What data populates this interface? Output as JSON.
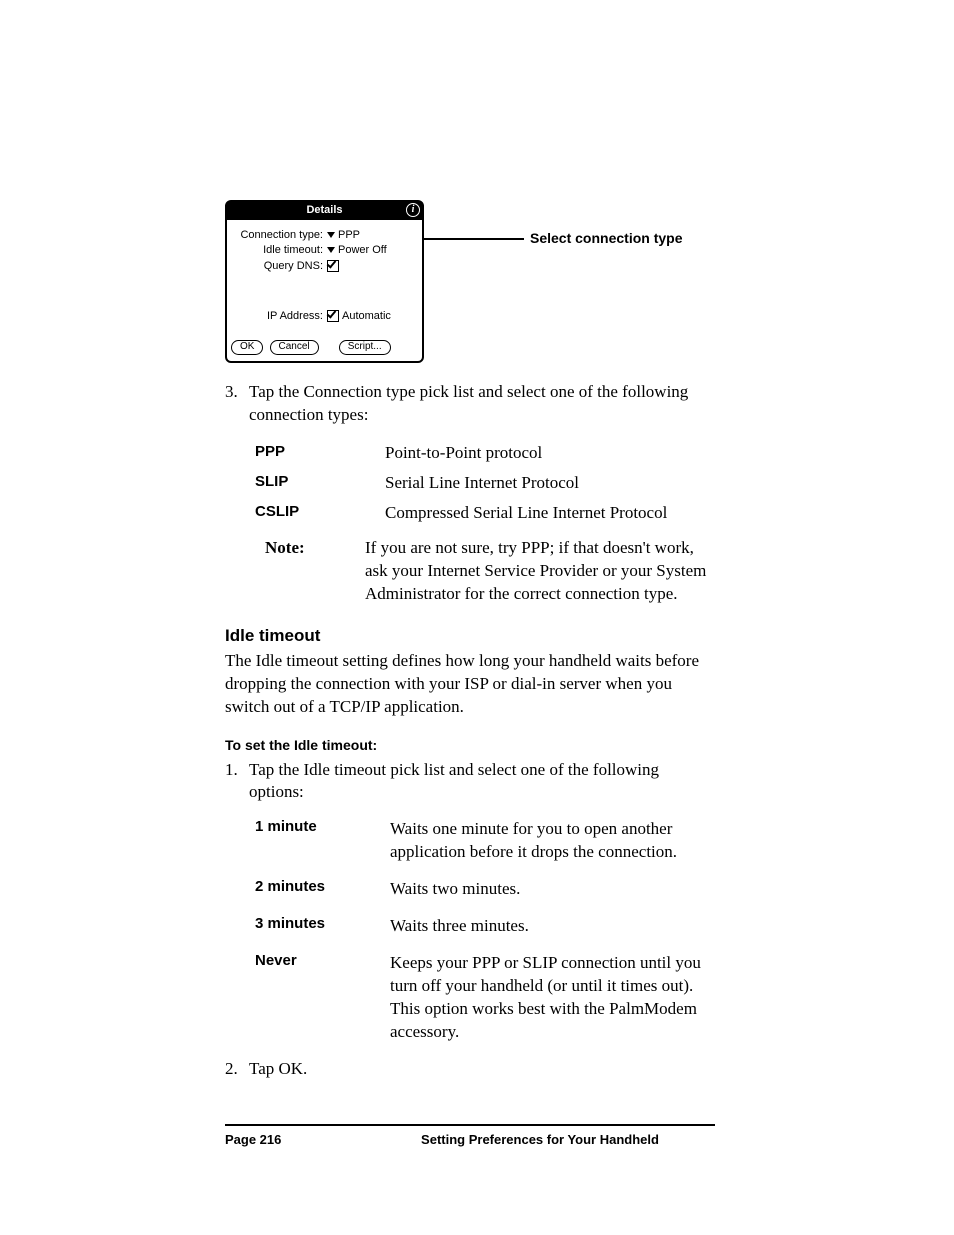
{
  "dialog": {
    "title": "Details",
    "info_glyph": "i",
    "rows": {
      "conn_label": "Connection type:",
      "conn_value": "PPP",
      "idle_label": "Idle timeout:",
      "idle_value": "Power Off",
      "qdns_label": "Query DNS:",
      "ip_label": "IP Address:",
      "ip_value": "Automatic"
    },
    "buttons": {
      "ok": "OK",
      "cancel": "Cancel",
      "script": "Script..."
    }
  },
  "callout": "Select connection type",
  "step3": {
    "num": "3.",
    "text": "Tap the Connection type pick list and select one of the following connection types:"
  },
  "protocols": [
    {
      "label": "PPP",
      "desc": "Point-to-Point protocol"
    },
    {
      "label": "SLIP",
      "desc": "Serial Line Internet Protocol"
    },
    {
      "label": "CSLIP",
      "desc": "Compressed Serial Line Internet Protocol"
    }
  ],
  "note": {
    "label": "Note:",
    "text": "If you are not sure, try PPP; if that doesn't work, ask your Internet Service Provider or your System Administrator for the correct connection type."
  },
  "idle_heading": "Idle timeout",
  "idle_para": "The Idle timeout setting defines how long your handheld waits before dropping the connection with your ISP or dial-in server when you switch out of a TCP/IP application.",
  "set_heading": "To set the Idle timeout:",
  "step1": {
    "num": "1.",
    "text": "Tap the Idle timeout pick list and select one of the following options:"
  },
  "options": [
    {
      "label": "1 minute",
      "desc": "Waits one minute for you to open another application before it drops the connection."
    },
    {
      "label": "2 minutes",
      "desc": "Waits two minutes."
    },
    {
      "label": "3 minutes",
      "desc": "Waits three minutes."
    },
    {
      "label": "Never",
      "desc": "Keeps your PPP or SLIP connection until you turn off your handheld (or until it times out). This option works best with the PalmModem accessory."
    }
  ],
  "step2": {
    "num": "2.",
    "text": "Tap OK."
  },
  "footer": {
    "page": "Page 216",
    "chapter": "Setting Preferences for Your Handheld"
  }
}
